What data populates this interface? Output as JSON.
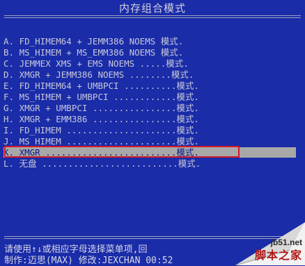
{
  "title": "内存组合模式",
  "menu": [
    {
      "text": "A. FD_HIMEM64 + JEMM386 NOEMS 模式."
    },
    {
      "text": "B. MS_HIMEM + MS_EMM386 NOEMS 模式."
    },
    {
      "text": "C. JEMMEX XMS + EMS NOEMS .....模式."
    },
    {
      "text": "D. XMGR + JEMM386 NOEMS ........模式."
    },
    {
      "text": "E. FD_HIMEM64 + UMBPCI ..........模式."
    },
    {
      "text": "F. MS_HIMEM + UMBPCI ............模式."
    },
    {
      "text": "G. XMGR + UMBPCI ................模式."
    },
    {
      "text": "H. XMGR + EMM386 ................模式."
    },
    {
      "text": "I. FD_HIMEM .....................模式."
    },
    {
      "text": "J. MS_HIMEM .....................模式."
    },
    {
      "text": "K. XMGR .........................模式."
    },
    {
      "text": "L. 无盘 ..........................模式."
    }
  ],
  "selected_index": 10,
  "footer": {
    "line1": "请使用↑↓或相应字母选择菜单项,回",
    "line2": "制作:迈思(MAX) 修改:JEXCHAN 00:52"
  },
  "watermark": {
    "site": "jb51.net",
    "name": "脚本之家"
  },
  "colors": {
    "background": "#1a2ca8",
    "highlight": "#a8a8a8",
    "selection_border": "#d11a2a"
  }
}
